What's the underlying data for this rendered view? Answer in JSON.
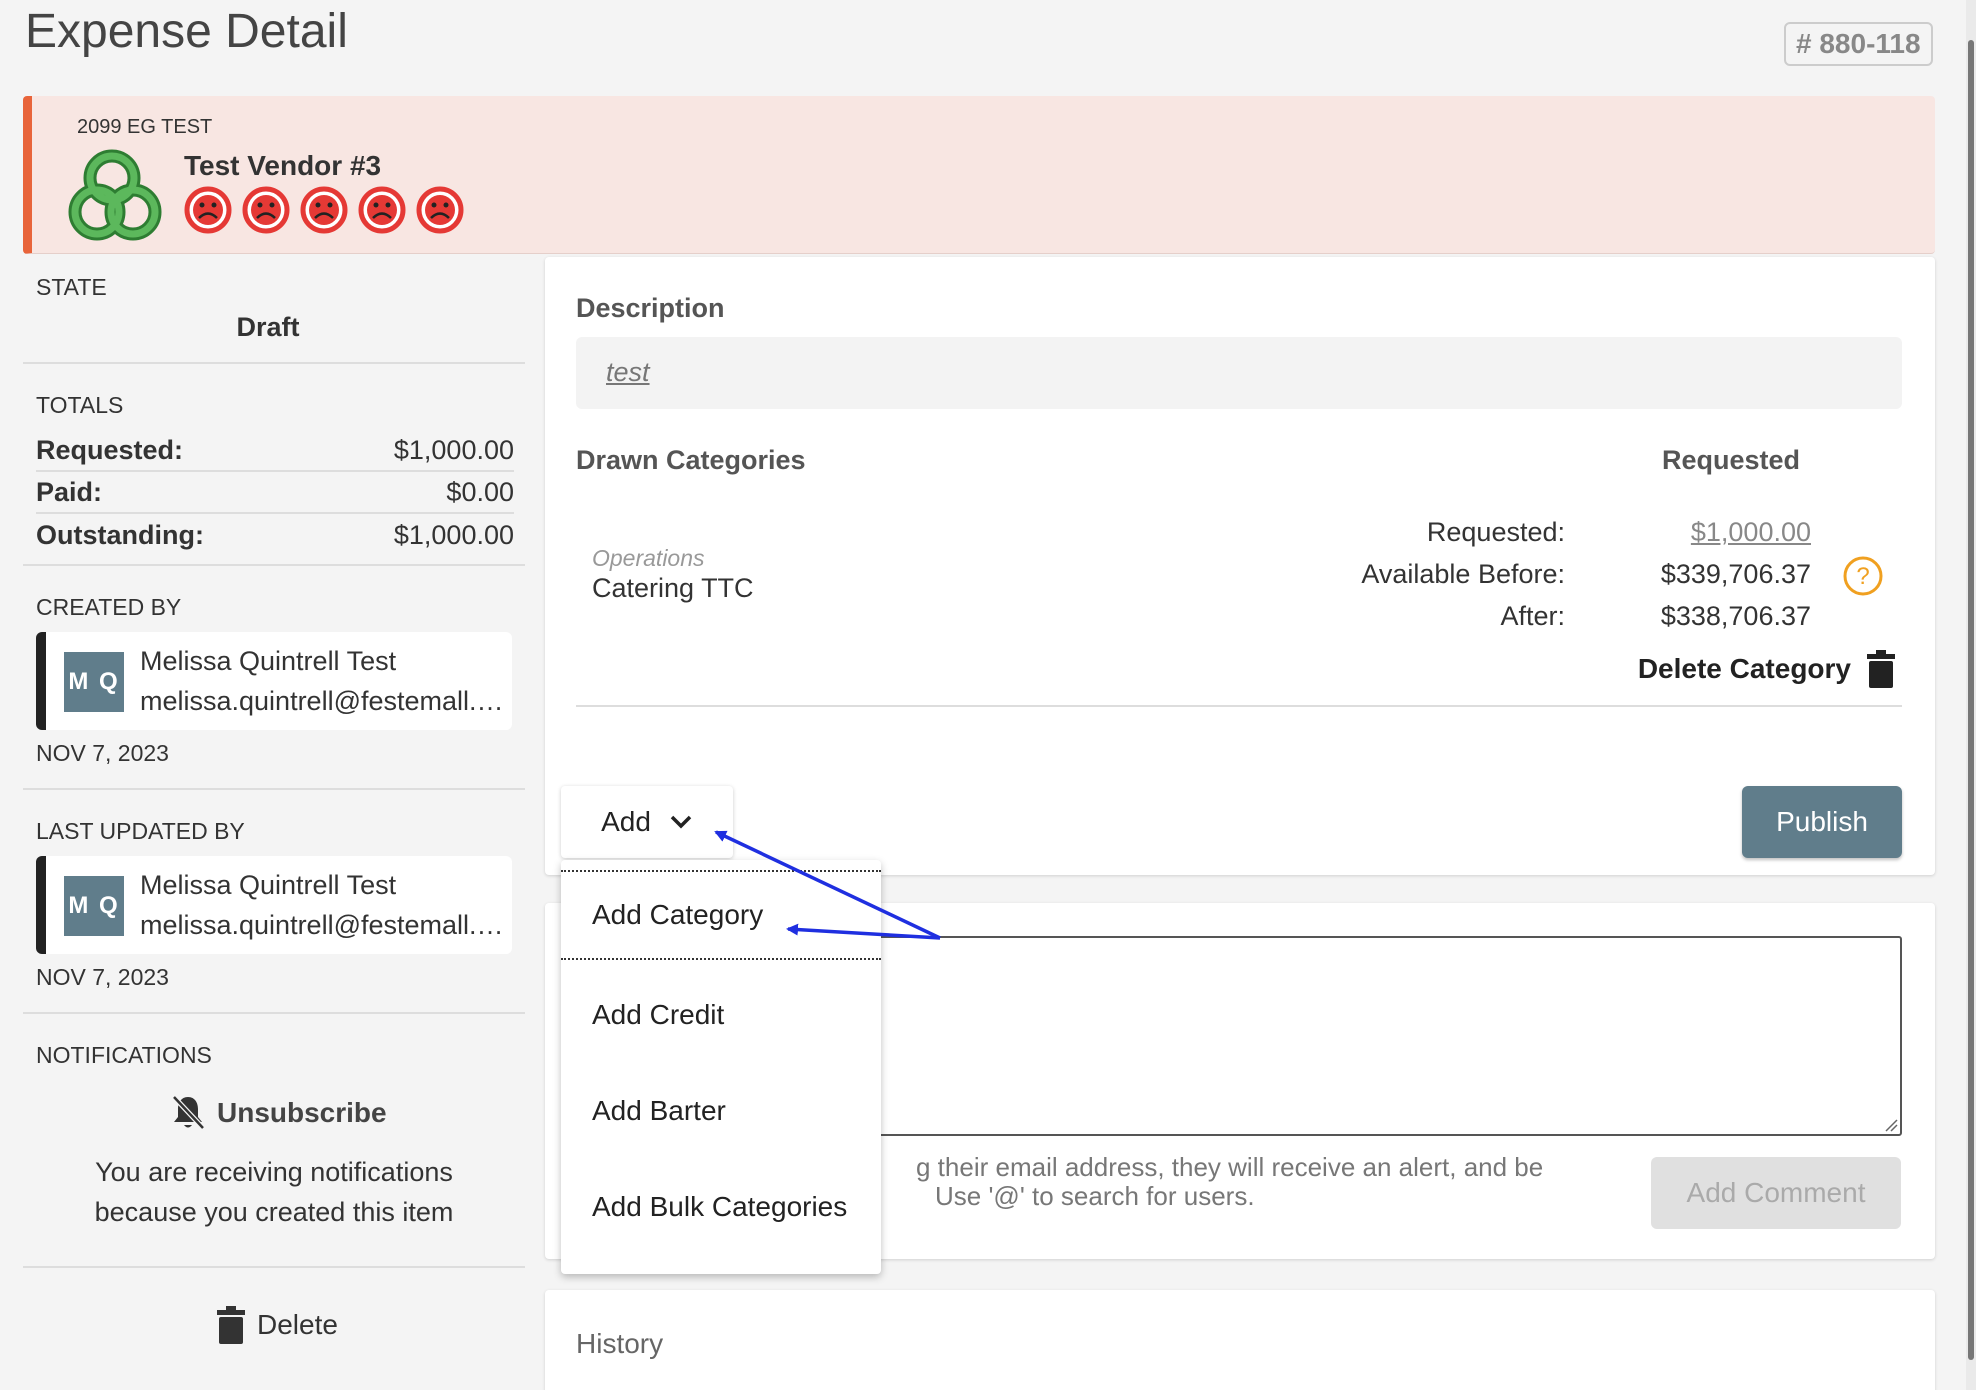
{
  "header": {
    "title": "Expense Detail",
    "record_id": "# 880-118"
  },
  "vendor": {
    "org": "2099 EG TEST",
    "name": "Test Vendor #3",
    "rating_icon": "sad-face-icon",
    "rating_count": 5,
    "rating_color": "#e53935",
    "banner_accent": "#e8643a"
  },
  "sidebar": {
    "state_label": "STATE",
    "state_value": "Draft",
    "totals_label": "TOTALS",
    "totals": [
      {
        "label": "Requested:",
        "value": "$1,000.00"
      },
      {
        "label": "Paid:",
        "value": "$0.00"
      },
      {
        "label": "Outstanding:",
        "value": "$1,000.00"
      }
    ],
    "created_by_label": "CREATED BY",
    "created_by": {
      "initials": "M Q",
      "name": "Melissa Quintrell Test",
      "email": "melissa.quintrell@festemall.com",
      "date": "NOV 7, 2023"
    },
    "updated_by_label": "LAST UPDATED BY",
    "updated_by": {
      "initials": "M Q",
      "name": "Melissa Quintrell Test",
      "email": "melissa.quintrell@festemall.com",
      "date": "NOV 7, 2023"
    },
    "notifications_label": "NOTIFICATIONS",
    "unsubscribe_label": "Unsubscribe",
    "notification_text_1": "You are receiving notifications",
    "notification_text_2": "because you created this item",
    "delete_label": "Delete"
  },
  "main": {
    "description_label": "Description",
    "description_value": "test",
    "categories_label": "Drawn Categories",
    "requested_header": "Requested",
    "category": {
      "group": "Operations",
      "name": "Catering TTC",
      "requested_label": "Requested:",
      "requested_value": "$1,000.00",
      "available_before_label": "Available Before:",
      "available_before_value": "$339,706.37",
      "after_label": "After:",
      "after_value": "$338,706.37",
      "delete_label": "Delete Category"
    },
    "add_label": "Add",
    "publish_label": "Publish",
    "accent": "#607d8b"
  },
  "comments": {
    "hint_line_1": "g their email address, they will receive an alert, and be",
    "hint_line_2": "Use '@' to search for users.",
    "add_comment_label": "Add Comment"
  },
  "history": {
    "label": "History"
  },
  "dropdown": {
    "items": [
      {
        "label": "Add Category"
      },
      {
        "label": "Add Credit"
      },
      {
        "label": "Add Barter"
      },
      {
        "label": "Add Bulk Categories"
      }
    ]
  },
  "annotation": {
    "arrow_color": "#1f2fe0"
  }
}
